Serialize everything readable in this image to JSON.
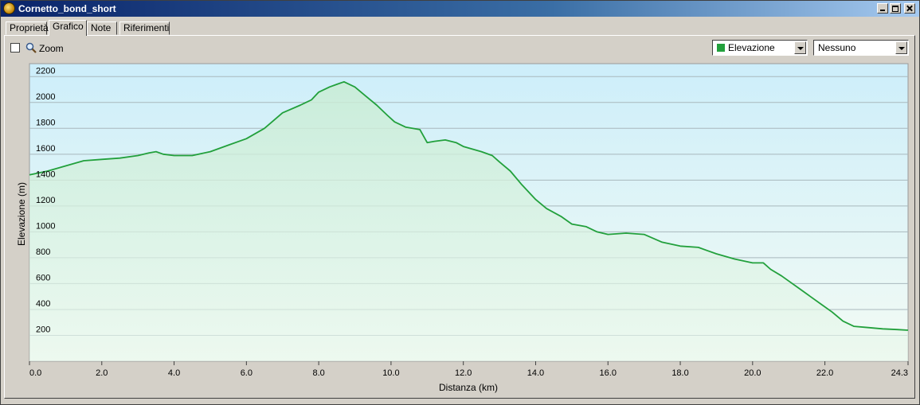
{
  "window": {
    "title": "Cornetto_bond_short"
  },
  "tabs": [
    {
      "label": "Proprietà"
    },
    {
      "label": "Grafico"
    },
    {
      "label": "Note"
    },
    {
      "label": "Riferimenti"
    }
  ],
  "toolbar": {
    "zoom_label": "Zoom",
    "zoom_checked": false
  },
  "selects": {
    "series": {
      "value": "Elevazione",
      "swatch_color": "#22a03c"
    },
    "secondary": {
      "value": "Nessuno"
    }
  },
  "chart_data": {
    "type": "area",
    "xlabel": "Distanza  (km)",
    "ylabel": "Elevazione (m)",
    "xlim": [
      0,
      24.3
    ],
    "ylim": [
      0,
      2300
    ],
    "x_ticks": [
      "0.0",
      "2.0",
      "4.0",
      "6.0",
      "8.0",
      "10.0",
      "12.0",
      "14.0",
      "16.0",
      "18.0",
      "20.0",
      "22.0",
      "24.3"
    ],
    "x_tick_values": [
      0,
      2,
      4,
      6,
      8,
      10,
      12,
      14,
      16,
      18,
      20,
      22,
      24.3
    ],
    "y_ticks": [
      "200",
      "400",
      "600",
      "800",
      "1000",
      "1200",
      "1400",
      "1600",
      "1800",
      "2000",
      "2200"
    ],
    "y_tick_values": [
      200,
      400,
      600,
      800,
      1000,
      1200,
      1400,
      1600,
      1800,
      2000,
      2200
    ],
    "grid": true,
    "line_color": "#22a03c",
    "series": [
      {
        "x": [
          0,
          0.5,
          1.0,
          1.5,
          2.0,
          2.5,
          3.0,
          3.3,
          3.5,
          3.7,
          4.0,
          4.5,
          5.0,
          5.5,
          6.0,
          6.5,
          7.0,
          7.5,
          7.8,
          8.0,
          8.3,
          8.5,
          8.7,
          9.0,
          9.3,
          9.6,
          9.9,
          10.1,
          10.4,
          10.8,
          11.0,
          11.2,
          11.5,
          11.8,
          12.0,
          12.5,
          12.8,
          13.0,
          13.3,
          13.6,
          14.0,
          14.3,
          14.7,
          15.0,
          15.4,
          15.7,
          16.0,
          16.5,
          17.0,
          17.5,
          18.0,
          18.5,
          19.0,
          19.5,
          20.0,
          20.3,
          20.5,
          20.8,
          21.0,
          21.3,
          21.6,
          21.9,
          22.2,
          22.5,
          22.8,
          23.2,
          23.6,
          24.0,
          24.3
        ],
        "y": [
          1440,
          1470,
          1510,
          1550,
          1560,
          1570,
          1590,
          1610,
          1620,
          1600,
          1590,
          1590,
          1620,
          1670,
          1720,
          1800,
          1920,
          1980,
          2020,
          2080,
          2120,
          2140,
          2160,
          2120,
          2050,
          1980,
          1900,
          1850,
          1810,
          1790,
          1690,
          1700,
          1710,
          1690,
          1660,
          1620,
          1590,
          1540,
          1470,
          1370,
          1250,
          1180,
          1120,
          1060,
          1040,
          1000,
          980,
          990,
          980,
          920,
          890,
          880,
          830,
          790,
          760,
          760,
          710,
          660,
          620,
          560,
          500,
          440,
          380,
          310,
          270,
          260,
          250,
          245,
          240
        ]
      }
    ]
  }
}
